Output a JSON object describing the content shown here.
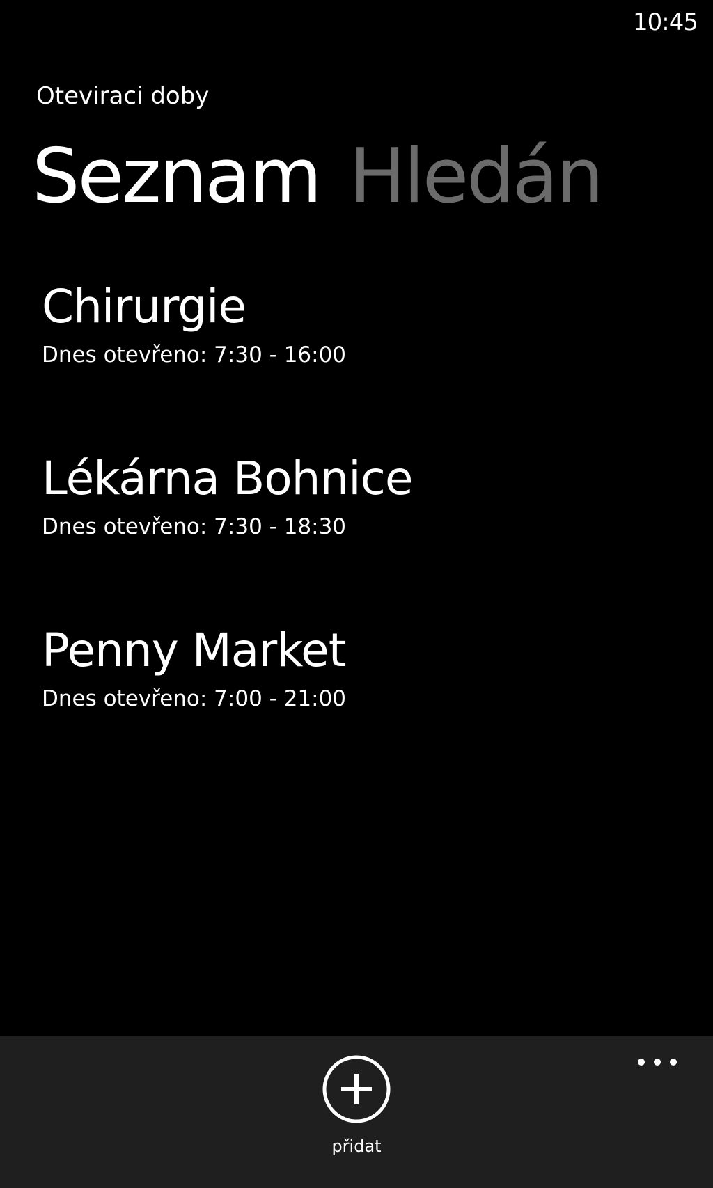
{
  "status_bar": {
    "time": "10:45"
  },
  "app": {
    "title": "Oteviraci doby"
  },
  "pivot": {
    "items": [
      {
        "label": "Seznam",
        "active": true
      },
      {
        "label": "Hledán",
        "active": false
      }
    ]
  },
  "list": {
    "items": [
      {
        "name": "Chirurgie",
        "hours": "Dnes otevřeno: 7:30 - 16:00"
      },
      {
        "name": "Lékárna Bohnice",
        "hours": "Dnes otevřeno: 7:30 - 18:30"
      },
      {
        "name": "Penny Market",
        "hours": "Dnes otevřeno: 7:00 - 21:00"
      }
    ]
  },
  "app_bar": {
    "add_icon": "plus-circle-icon",
    "add_label": "přidat",
    "more_icon": "ellipsis-icon"
  },
  "colors": {
    "background": "#000000",
    "foreground": "#ffffff",
    "inactive_pivot": "#6b6b6b",
    "app_bar": "#1f1f1f"
  }
}
